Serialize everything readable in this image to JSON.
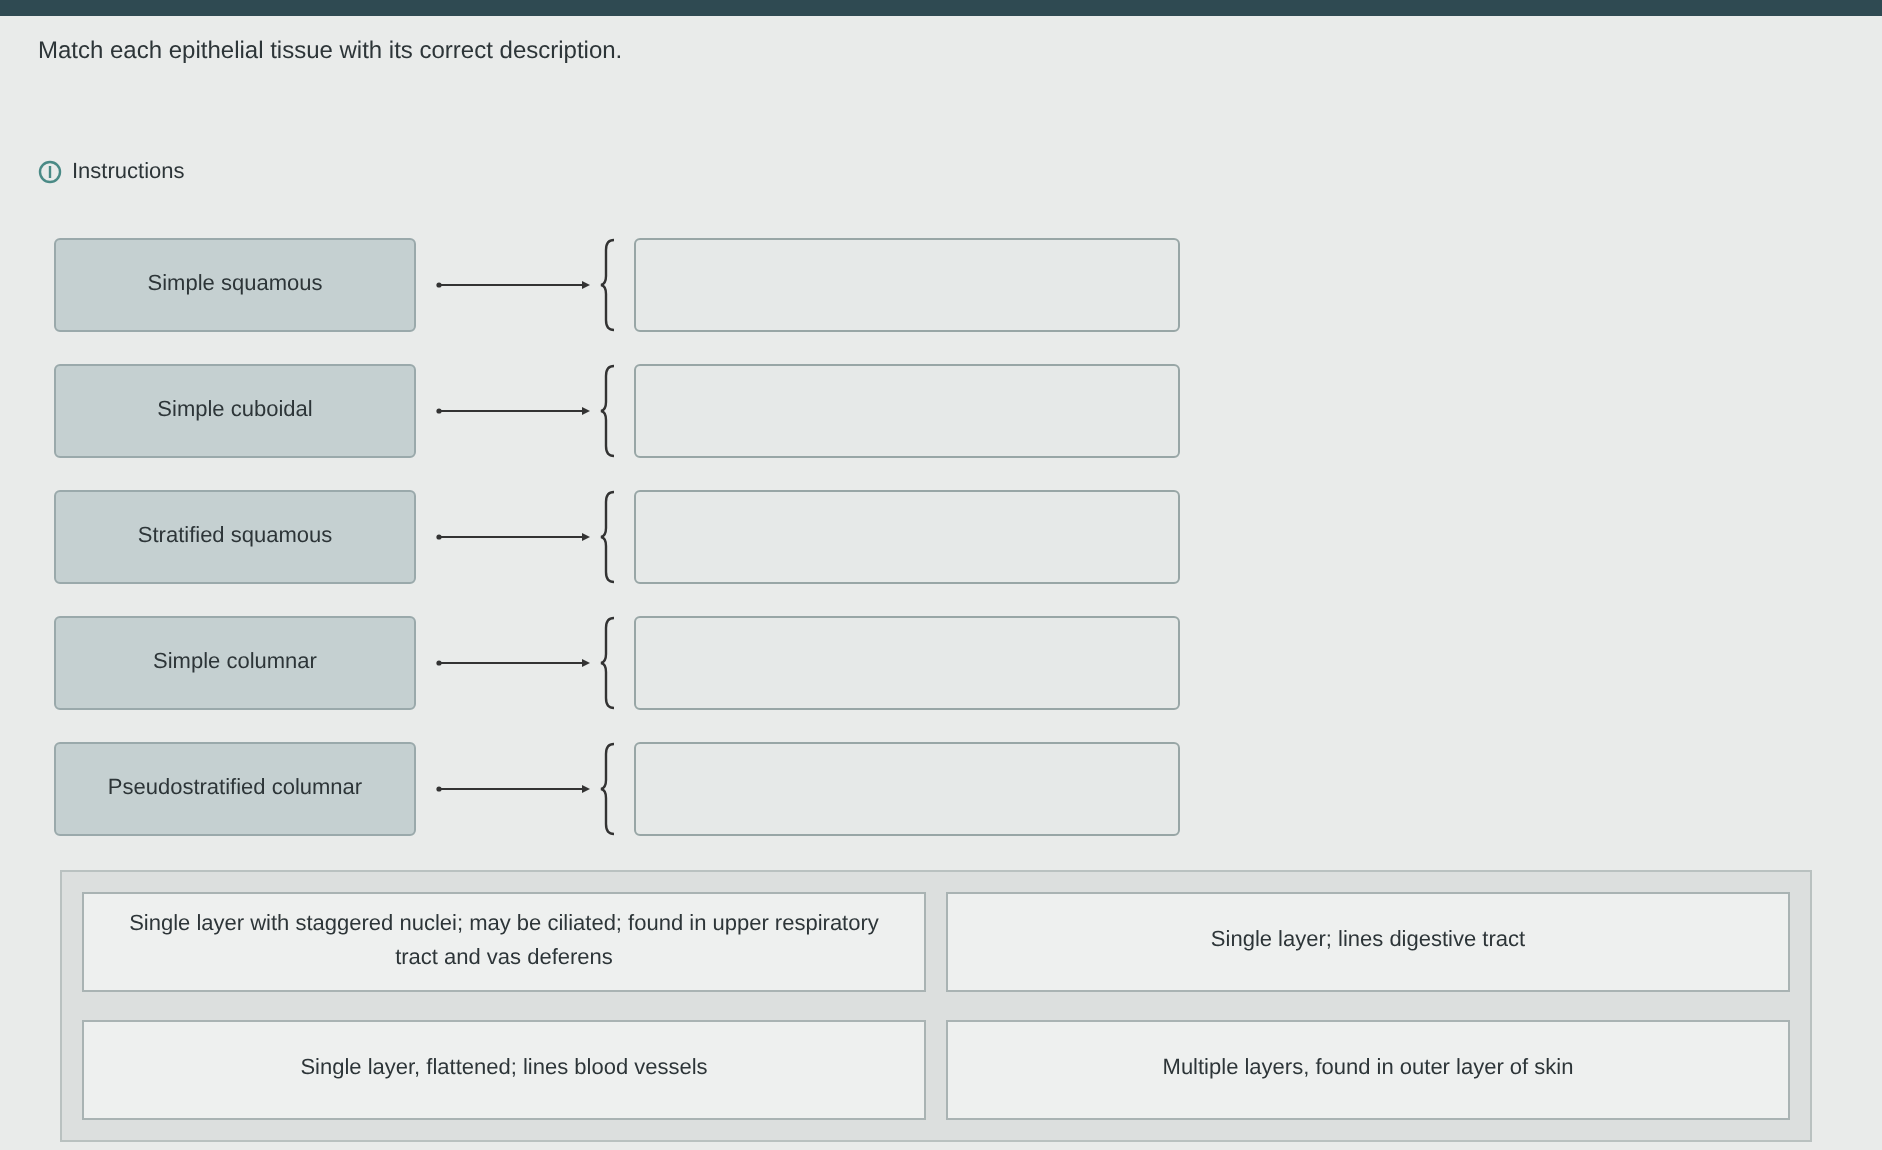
{
  "question": "Match each epithelial tissue with its correct description.",
  "instructions": {
    "label": "Instructions"
  },
  "terms": [
    {
      "label": "Simple squamous"
    },
    {
      "label": "Simple cuboidal"
    },
    {
      "label": "Stratified squamous"
    },
    {
      "label": "Simple columnar"
    },
    {
      "label": "Pseudostratified columnar"
    }
  ],
  "descriptions": [
    "Single layer with staggered nuclei; may be ciliated; found in upper respiratory tract and vas deferens",
    "Single layer; lines digestive tract",
    "Single layer, flattened; lines blood vessels",
    "Multiple layers, found in outer layer of skin"
  ]
}
